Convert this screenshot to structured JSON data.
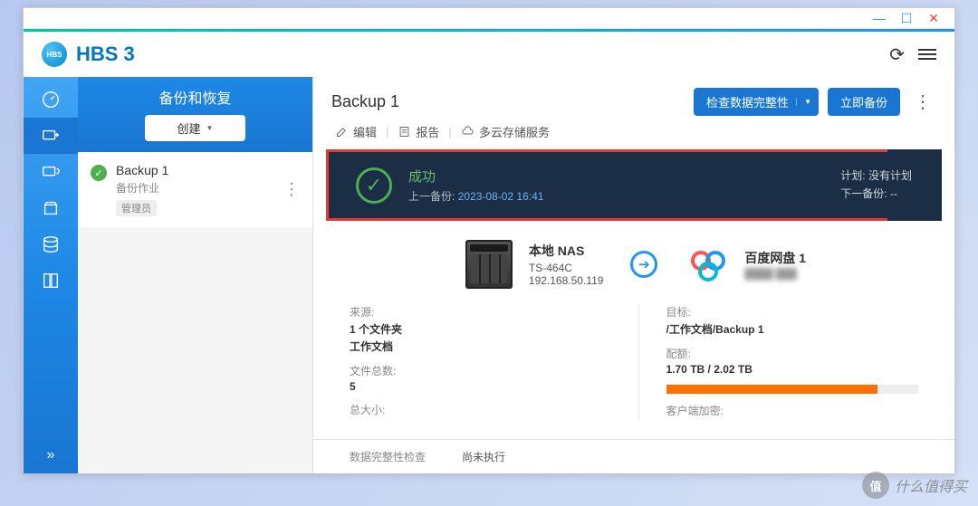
{
  "app": {
    "title": "HBS 3",
    "logo_text": "HBS"
  },
  "sidebar": {
    "title": "备份和恢复",
    "create_label": "创建"
  },
  "job": {
    "name": "Backup 1",
    "type": "备份作业",
    "owner": "管理员"
  },
  "main": {
    "title": "Backup 1",
    "check_btn": "检查数据完整性",
    "backup_now": "立即备份"
  },
  "actions": {
    "edit": "编辑",
    "report": "报告",
    "multicloud": "多云存储服务"
  },
  "status": {
    "title": "成功",
    "last_label": "上一备份:",
    "last_time": "2023-08-02 16:41",
    "plan_label": "计划:",
    "plan_value": "没有计划",
    "next_label": "下一备份:",
    "next_value": "--"
  },
  "source": {
    "title": "本地 NAS",
    "model": "TS-464C",
    "ip": "192.168.50.119"
  },
  "dest": {
    "title": "百度网盘 1"
  },
  "details": {
    "source_label": "来源:",
    "source_count": "1 个文件夹",
    "source_path": "工作文档",
    "files_label": "文件总数:",
    "files_value": "5",
    "size_label": "总大小:",
    "target_label": "目标:",
    "target_value": "/工作文档/Backup 1",
    "quota_label": "配额:",
    "quota_value": "1.70 TB / 2.02 TB",
    "encrypt_label": "客户端加密:"
  },
  "footer": {
    "integrity_label": "数据完整性检查",
    "integrity_value": "尚未执行"
  },
  "watermark": {
    "icon": "值",
    "text": "什么值得买"
  }
}
